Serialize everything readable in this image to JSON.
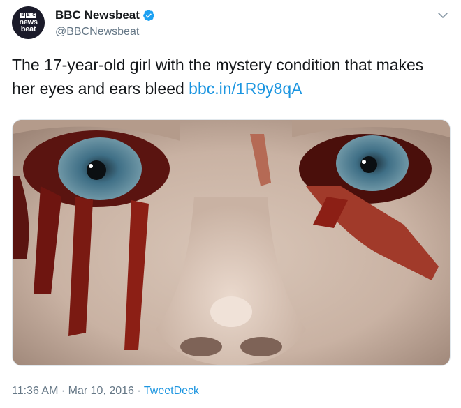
{
  "author": {
    "avatar_text": {
      "logo_letters": [
        "B",
        "B",
        "C"
      ],
      "line1": "news",
      "line2": "beat"
    },
    "name": "BBC Newsbeat",
    "handle": "@BBCNewsbeat",
    "verified": true
  },
  "tweet": {
    "text": "The 17-year-old girl with the mystery condition that makes her eyes and ears bleed",
    "link": "bbc.in/1R9y8qA"
  },
  "media": {
    "icon": "photo"
  },
  "meta": {
    "time": "11:36 AM",
    "separator": "·",
    "date": "Mar 10, 2016",
    "source": "TweetDeck"
  },
  "colors": {
    "link": "#1b95e0",
    "secondary": "#657786",
    "verified": "#1da1f2"
  }
}
